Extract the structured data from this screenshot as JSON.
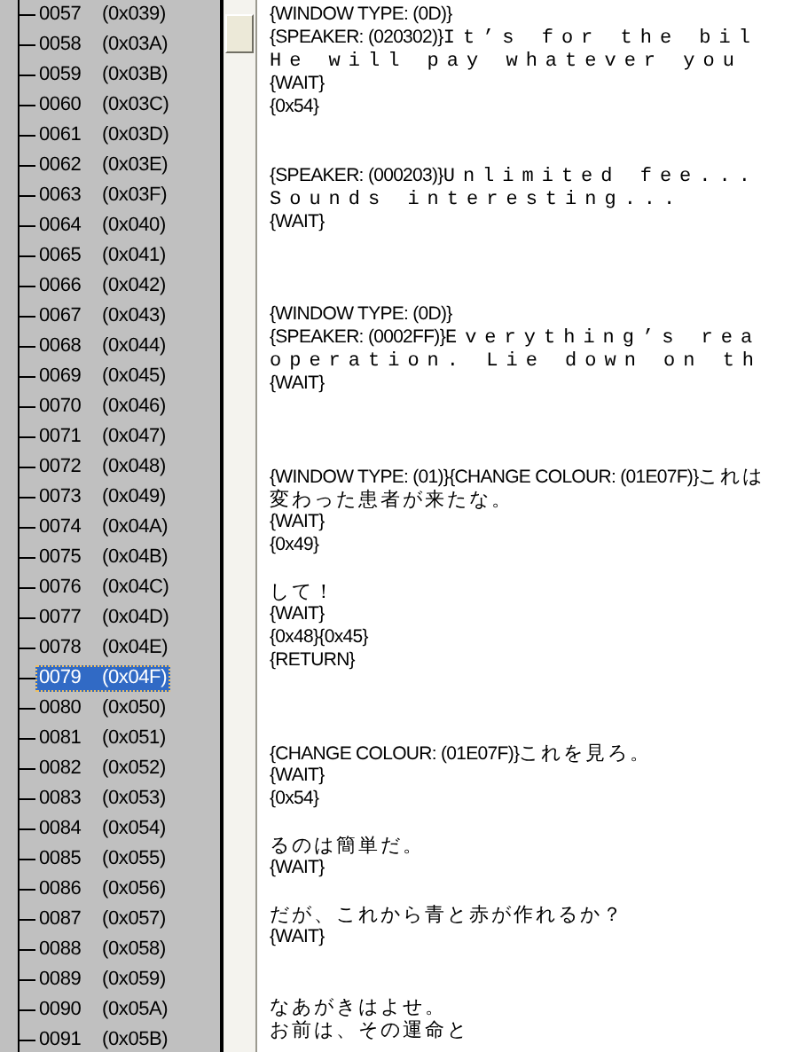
{
  "tree": {
    "items": [
      {
        "number": "0057",
        "hex": "(0x039)",
        "selected": false
      },
      {
        "number": "0058",
        "hex": "(0x03A)",
        "selected": false
      },
      {
        "number": "0059",
        "hex": "(0x03B)",
        "selected": false
      },
      {
        "number": "0060",
        "hex": "(0x03C)",
        "selected": false
      },
      {
        "number": "0061",
        "hex": "(0x03D)",
        "selected": false
      },
      {
        "number": "0062",
        "hex": "(0x03E)",
        "selected": false
      },
      {
        "number": "0063",
        "hex": "(0x03F)",
        "selected": false
      },
      {
        "number": "0064",
        "hex": "(0x040)",
        "selected": false
      },
      {
        "number": "0065",
        "hex": "(0x041)",
        "selected": false
      },
      {
        "number": "0066",
        "hex": "(0x042)",
        "selected": false
      },
      {
        "number": "0067",
        "hex": "(0x043)",
        "selected": false
      },
      {
        "number": "0068",
        "hex": "(0x044)",
        "selected": false
      },
      {
        "number": "0069",
        "hex": "(0x045)",
        "selected": false
      },
      {
        "number": "0070",
        "hex": "(0x046)",
        "selected": false
      },
      {
        "number": "0071",
        "hex": "(0x047)",
        "selected": false
      },
      {
        "number": "0072",
        "hex": "(0x048)",
        "selected": false
      },
      {
        "number": "0073",
        "hex": "(0x049)",
        "selected": false
      },
      {
        "number": "0074",
        "hex": "(0x04A)",
        "selected": false
      },
      {
        "number": "0075",
        "hex": "(0x04B)",
        "selected": false
      },
      {
        "number": "0076",
        "hex": "(0x04C)",
        "selected": false
      },
      {
        "number": "0077",
        "hex": "(0x04D)",
        "selected": false
      },
      {
        "number": "0078",
        "hex": "(0x04E)",
        "selected": false
      },
      {
        "number": "0079",
        "hex": "(0x04F)",
        "selected": true
      },
      {
        "number": "0080",
        "hex": "(0x050)",
        "selected": false
      },
      {
        "number": "0081",
        "hex": "(0x051)",
        "selected": false
      },
      {
        "number": "0082",
        "hex": "(0x052)",
        "selected": false
      },
      {
        "number": "0083",
        "hex": "(0x053)",
        "selected": false
      },
      {
        "number": "0084",
        "hex": "(0x054)",
        "selected": false
      },
      {
        "number": "0085",
        "hex": "(0x055)",
        "selected": false
      },
      {
        "number": "0086",
        "hex": "(0x056)",
        "selected": false
      },
      {
        "number": "0087",
        "hex": "(0x057)",
        "selected": false
      },
      {
        "number": "0088",
        "hex": "(0x058)",
        "selected": false
      },
      {
        "number": "0089",
        "hex": "(0x059)",
        "selected": false
      },
      {
        "number": "0090",
        "hex": "(0x05A)",
        "selected": false
      },
      {
        "number": "0091",
        "hex": "(0x05B)",
        "selected": false
      }
    ]
  },
  "script": {
    "lines": [
      {
        "kind": "code",
        "tag": "{WINDOW TYPE: (0D)}"
      },
      {
        "kind": "latin",
        "tag": "{SPEAKER: (020302)}",
        "speech": "It’s for the bil"
      },
      {
        "kind": "latin",
        "speech": "He will pay whatever you"
      },
      {
        "kind": "code",
        "tag": "{WAIT}"
      },
      {
        "kind": "code",
        "tag": "{0x54}"
      },
      {
        "kind": "blank"
      },
      {
        "kind": "blank"
      },
      {
        "kind": "latin",
        "tag": "{SPEAKER: (000203)}",
        "speech": "Unlimited fee..."
      },
      {
        "kind": "latin",
        "speech": "Sounds interesting..."
      },
      {
        "kind": "code",
        "tag": "{WAIT}"
      },
      {
        "kind": "blank"
      },
      {
        "kind": "blank"
      },
      {
        "kind": "blank"
      },
      {
        "kind": "code",
        "tag": "{WINDOW TYPE: (0D)}"
      },
      {
        "kind": "latin",
        "tag": "{SPEAKER: (0002FF)}",
        "speech": "Everything’s rea"
      },
      {
        "kind": "latin",
        "speech": "operation. Lie down on th"
      },
      {
        "kind": "code",
        "tag": "{WAIT}"
      },
      {
        "kind": "blank"
      },
      {
        "kind": "blank"
      },
      {
        "kind": "blank"
      },
      {
        "kind": "japanese",
        "tag": "{WINDOW TYPE: (01)}{CHANGE COLOUR: (01E07F)}",
        "speech": "これは"
      },
      {
        "kind": "japanese",
        "speech": "変わった患者が来たな。"
      },
      {
        "kind": "code",
        "tag": "{WAIT}"
      },
      {
        "kind": "code",
        "tag": "{0x49}"
      },
      {
        "kind": "blank"
      },
      {
        "kind": "japanese",
        "speech": "して！"
      },
      {
        "kind": "code",
        "tag": "{WAIT}"
      },
      {
        "kind": "code",
        "tag": "{0x48}{0x45}"
      },
      {
        "kind": "code",
        "tag": "{RETURN}"
      },
      {
        "kind": "blank"
      },
      {
        "kind": "blank"
      },
      {
        "kind": "blank"
      },
      {
        "kind": "japanese",
        "tag": "{CHANGE COLOUR: (01E07F)}",
        "speech": "これを見ろ。"
      },
      {
        "kind": "code",
        "tag": "{WAIT}"
      },
      {
        "kind": "code",
        "tag": "{0x54}"
      },
      {
        "kind": "blank"
      },
      {
        "kind": "japanese",
        "speech": "るのは簡単だ。"
      },
      {
        "kind": "code",
        "tag": "{WAIT}"
      },
      {
        "kind": "blank"
      },
      {
        "kind": "japanese",
        "speech": "だが、これから青と赤が作れるか？"
      },
      {
        "kind": "code",
        "tag": "{WAIT}"
      },
      {
        "kind": "blank"
      },
      {
        "kind": "blank"
      },
      {
        "kind": "japanese",
        "speech": "なあがきはよせ。"
      },
      {
        "kind": "japanese",
        "speech": "お前は、その運命と"
      }
    ]
  }
}
